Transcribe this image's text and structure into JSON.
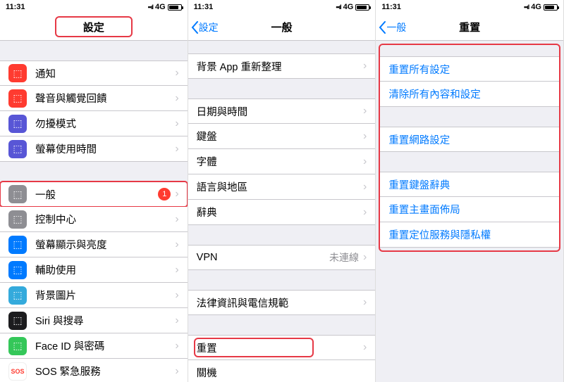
{
  "status": {
    "time": "11:31",
    "net": "4G",
    "signal": "••ıl"
  },
  "s1": {
    "title": "設定",
    "rows1": [
      {
        "name": "notifications",
        "label": "通知",
        "iconBg": "bg-red"
      },
      {
        "name": "sounds",
        "label": "聲音與觸覺回饋",
        "iconBg": "bg-red"
      },
      {
        "name": "dnd",
        "label": "勿擾模式",
        "iconBg": "bg-purple"
      },
      {
        "name": "screentime",
        "label": "螢幕使用時間",
        "iconBg": "bg-indigo"
      }
    ],
    "rows2": [
      {
        "name": "general",
        "label": "一般",
        "iconBg": "bg-gray",
        "badge": "1",
        "highlight": true
      },
      {
        "name": "control-center",
        "label": "控制中心",
        "iconBg": "bg-gray"
      },
      {
        "name": "display",
        "label": "螢幕顯示與亮度",
        "iconBg": "bg-blue"
      },
      {
        "name": "accessibility",
        "label": "輔助使用",
        "iconBg": "bg-blue"
      },
      {
        "name": "wallpaper",
        "label": "背景圖片",
        "iconBg": "bg-cyan"
      },
      {
        "name": "siri",
        "label": "Siri 與搜尋",
        "iconBg": "bg-black"
      },
      {
        "name": "faceid",
        "label": "Face ID 與密碼",
        "iconBg": "bg-green"
      },
      {
        "name": "sos",
        "label": "SOS 緊急服務",
        "iconBg": "bg-sos",
        "iconText": "SOS",
        "iconColor": "#ff3b30"
      }
    ]
  },
  "s2": {
    "back": "設定",
    "title": "一般",
    "grp1": [
      {
        "name": "bg-refresh",
        "label": "背景 App 重新整理"
      }
    ],
    "grp2": [
      {
        "name": "date-time",
        "label": "日期與時間"
      },
      {
        "name": "keyboard",
        "label": "鍵盤"
      },
      {
        "name": "fonts",
        "label": "字體"
      },
      {
        "name": "language",
        "label": "語言與地區"
      },
      {
        "name": "dictionary",
        "label": "辭典"
      }
    ],
    "grp3": [
      {
        "name": "vpn",
        "label": "VPN",
        "value": "未連線"
      }
    ],
    "grp4": [
      {
        "name": "legal",
        "label": "法律資訊與電信規範"
      }
    ],
    "grp5": [
      {
        "name": "reset",
        "label": "重置",
        "highlight": true
      },
      {
        "name": "shutdown",
        "label": "關機",
        "noChev": true
      }
    ]
  },
  "s3": {
    "back": "一般",
    "title": "重置",
    "grp1": [
      {
        "name": "reset-all-settings",
        "label": "重置所有設定"
      },
      {
        "name": "erase-all",
        "label": "清除所有內容和設定"
      }
    ],
    "grp2": [
      {
        "name": "reset-network",
        "label": "重置網路設定"
      }
    ],
    "grp3": [
      {
        "name": "reset-keyboard-dict",
        "label": "重置鍵盤辭典"
      },
      {
        "name": "reset-home-layout",
        "label": "重置主畫面佈局"
      },
      {
        "name": "reset-location-privacy",
        "label": "重置定位服務與隱私權"
      }
    ]
  }
}
